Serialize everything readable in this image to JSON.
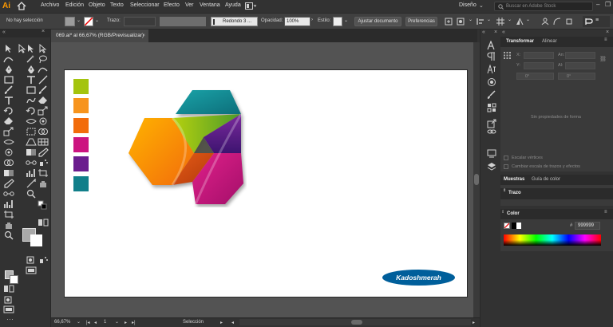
{
  "app": {
    "logo": "Ai",
    "workspace": "Diseño",
    "search_placeholder": "Buscar en Adobe Stock"
  },
  "menu": [
    "Archivo",
    "Edición",
    "Objeto",
    "Texto",
    "Seleccionar",
    "Efecto",
    "Ver",
    "Ventana",
    "Ayuda"
  ],
  "control_bar": {
    "selection_status": "No hay selección",
    "stroke_label": "Trazo:",
    "brush_label": "Redondo 3 ...",
    "opacity_label": "Opacidad:",
    "opacity_value": "100%",
    "style_label": "Estilo:",
    "fit_document_button": "Ajustar documento",
    "preferences_button": "Preferencias"
  },
  "document": {
    "tab_title": "069.ai* al 66,67% (RGB/Previsualizar)",
    "tab_close": "×"
  },
  "artwork": {
    "badge_text": "Kadoshmerah",
    "swatches": [
      "#a4c40e",
      "#f7941d",
      "#f26c0b",
      "#cc1480",
      "#6b1d8e",
      "#117f8a"
    ]
  },
  "status_bar": {
    "zoom": "66,67%",
    "artboard_number": "1",
    "tool_status": "Selección"
  },
  "transform_panel": {
    "tabs": [
      "Transformar",
      "Alinear"
    ],
    "fields": [
      "X:",
      "Y:",
      "An:",
      "Al:"
    ],
    "angle_label": "0°",
    "empty_message": "Sin propiedades de forma",
    "scale_corners": "Escalar vértices",
    "scale_strokes": "Cambiar escala de trazos y efectos"
  },
  "swatches_panel": {
    "tabs": [
      "Muestras",
      "Guía de color"
    ]
  },
  "stroke_panel": {
    "title": "Trazo"
  },
  "color_panel": {
    "title": "Color",
    "hex_symbol": "#",
    "hex_value": "999999"
  },
  "colors": {
    "accent_orange": "#ff9a00",
    "badge_blue": "#005f9b"
  }
}
